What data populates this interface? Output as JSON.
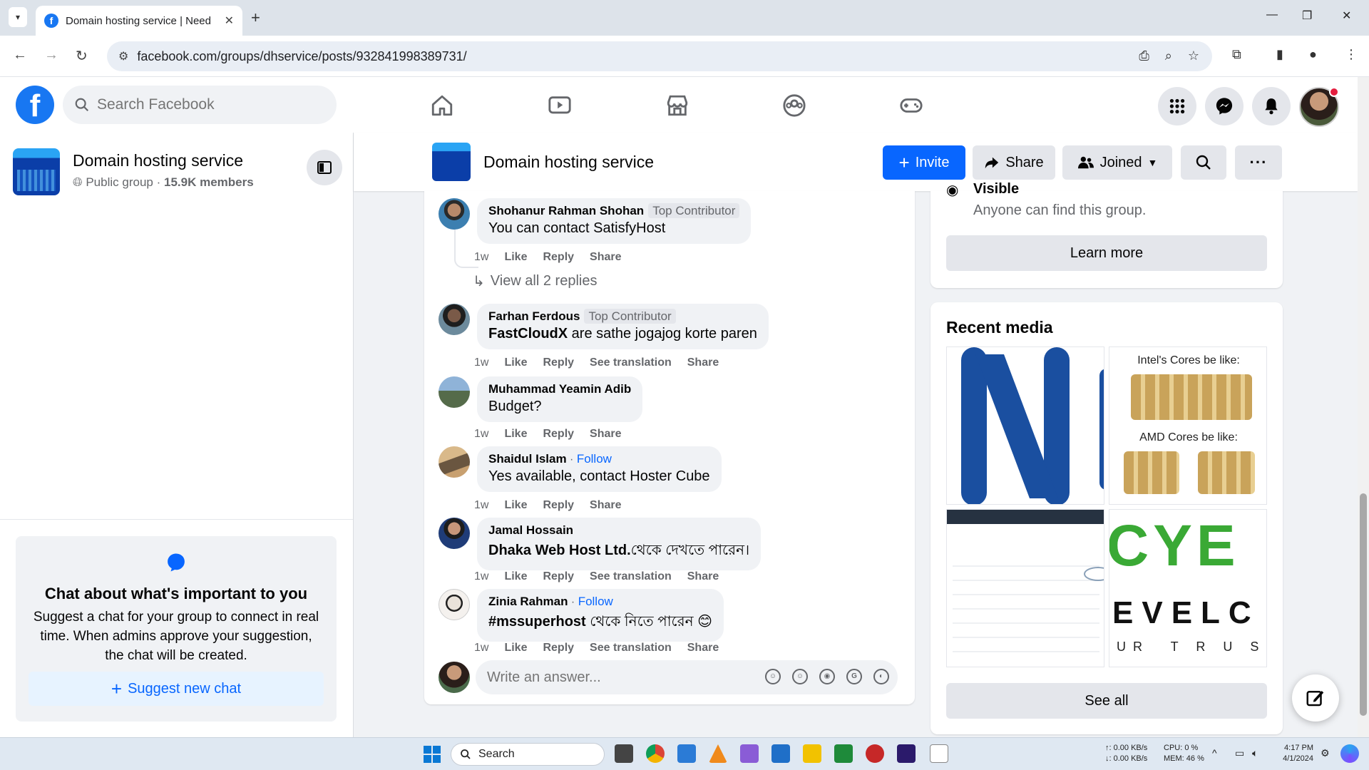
{
  "browser": {
    "tab_title": "Domain hosting service | Need ",
    "url": "facebook.com/groups/dhservice/posts/932841998389731/"
  },
  "facebook": {
    "search_placeholder": "Search Facebook"
  },
  "sidebar": {
    "group_name": "Domain hosting service",
    "group_privacy": "Public group",
    "group_members": "15.9K members",
    "chat_title": "Chat about what's important to you",
    "chat_desc": "Suggest a chat for your group to connect in real time. When admins approve your suggestion, the chat will be created.",
    "suggest_label": "Suggest new chat"
  },
  "group_header": {
    "name": "Domain hosting service",
    "invite_label": "Invite",
    "share_label": "Share",
    "joined_label": "Joined"
  },
  "comments": [
    {
      "author": "Shohanur Rahman Shohan",
      "badge": "Top Contributor",
      "text": "You can contact SatisfyHost",
      "time": "1w",
      "actions": [
        "Like",
        "Reply",
        "Share"
      ]
    },
    {
      "author": "Farhan Ferdous",
      "badge": "Top Contributor",
      "text_bold": "FastCloudX",
      "text": " are sathe jogajog korte paren",
      "time": "1w",
      "actions": [
        "Like",
        "Reply",
        "See translation",
        "Share"
      ]
    },
    {
      "author": "Muhammad Yeamin Adib",
      "text": "Budget?",
      "time": "1w",
      "actions": [
        "Like",
        "Reply",
        "Share"
      ]
    },
    {
      "author": "Shaidul Islam",
      "follow": "Follow",
      "text": "Yes available, contact Hoster Cube",
      "time": "1w",
      "actions": [
        "Like",
        "Reply",
        "Share"
      ]
    },
    {
      "author": "Jamal Hossain",
      "text_bold": "Dhaka Web Host Ltd.",
      "text": "থেকে দেখতে পারেন।",
      "time": "1w",
      "actions": [
        "Like",
        "Reply",
        "See translation",
        "Share"
      ]
    },
    {
      "author": "Zinia Rahman",
      "follow": "Follow",
      "text_bold": "#mssuperhost",
      "text": " থেকে নিতে পারেন 😊",
      "time": "1w",
      "actions": [
        "Like",
        "Reply",
        "See translation",
        "Share"
      ]
    }
  ],
  "view_replies": "View all 2 replies",
  "write_placeholder": "Write an answer...",
  "about": {
    "visible_title": "Visible",
    "visible_desc": "Anyone can find this group.",
    "learn_more": "Learn more"
  },
  "media": {
    "title": "Recent media",
    "tile2_line1": "Intel's Cores be like:",
    "tile2_line2": "AMD Cores be like:",
    "tile4_top": "CYE",
    "tile4_mid": "EVELC",
    "tile4_bot": "UR  T R U S",
    "see_all": "See all"
  },
  "taskbar": {
    "search_label": "Search",
    "net_up": "↑: 0.00 KB/s",
    "net_down": "↓: 0.00 KB/s",
    "cpu": "CPU: 0 %",
    "mem": "MEM: 46 %",
    "time": "4:17 PM",
    "date": "4/1/2024"
  },
  "colors": {
    "fb_blue": "#0866ff",
    "bubble_gray": "#f0f2f5",
    "secondary_text": "#65676b"
  }
}
